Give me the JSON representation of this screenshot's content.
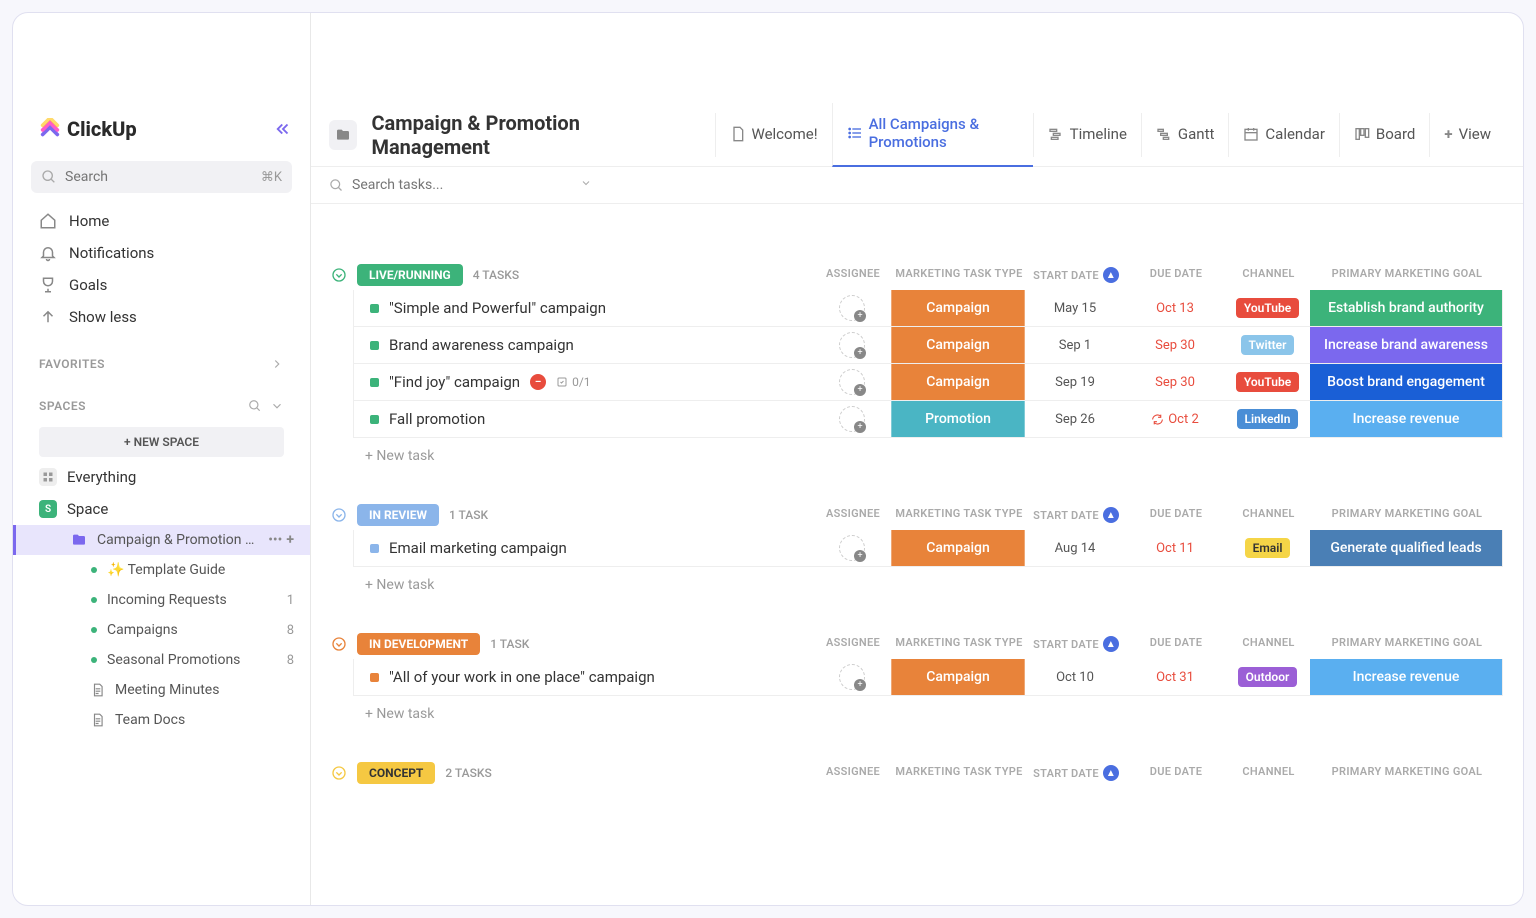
{
  "brand": "ClickUp",
  "sidebar": {
    "search_placeholder": "Search",
    "search_shortcut": "⌘K",
    "nav": [
      {
        "label": "Home"
      },
      {
        "label": "Notifications"
      },
      {
        "label": "Goals"
      },
      {
        "label": "Show less"
      }
    ],
    "favorites_label": "FAVORITES",
    "spaces_label": "SPACES",
    "new_space": "NEW SPACE",
    "everything": "Everything",
    "space_name": "Space",
    "folder": {
      "name": "Campaign & Promotion M...",
      "items": [
        {
          "label": "✨ Template Guide",
          "dot": "#3cb37a"
        },
        {
          "label": "Incoming Requests",
          "dot": "#3cb37a",
          "count": "1"
        },
        {
          "label": "Campaigns",
          "dot": "#3cb37a",
          "count": "8"
        },
        {
          "label": "Seasonal Promotions",
          "dot": "#3cb37a",
          "count": "8"
        },
        {
          "label": "Meeting Minutes",
          "doc": true
        },
        {
          "label": "Team Docs",
          "doc": true
        }
      ]
    }
  },
  "header": {
    "title": "Campaign & Promotion Management",
    "tabs": [
      {
        "label": "Welcome!"
      },
      {
        "label": "All Campaigns & Promotions",
        "active": true
      },
      {
        "label": "Timeline"
      },
      {
        "label": "Gantt"
      },
      {
        "label": "Calendar"
      },
      {
        "label": "Board"
      },
      {
        "label": "View",
        "add": true
      }
    ],
    "search_placeholder": "Search tasks..."
  },
  "columns": {
    "assignee": "ASSIGNEE",
    "type": "MARKETING TASK TYPE",
    "start": "START DATE",
    "due": "DUE DATE",
    "channel": "CHANNEL",
    "goal": "PRIMARY MARKETING GOAL"
  },
  "groups": [
    {
      "status": "LIVE/RUNNING",
      "pill_color": "#3cb37a",
      "count": "4 TASKS",
      "collapse_color": "#3cb37a",
      "tasks": [
        {
          "name": "\"Simple and Powerful\" campaign",
          "dot": "#3cb37a",
          "type": "Campaign",
          "type_color": "#e8833a",
          "start": "May 15",
          "due": "Oct 13",
          "due_red": true,
          "channel": "YouTube",
          "channel_color": "#e84c3d",
          "goal": "Establish brand authority",
          "goal_color": "#3cb37a"
        },
        {
          "name": "Brand awareness campaign",
          "dot": "#3cb37a",
          "type": "Campaign",
          "type_color": "#e8833a",
          "start": "Sep 1",
          "due": "Sep 30",
          "due_red": true,
          "channel": "Twitter",
          "channel_color": "#8bc5ea",
          "goal": "Increase brand awareness",
          "goal_color": "#7b68ee"
        },
        {
          "name": "\"Find joy\" campaign",
          "dot": "#3cb37a",
          "blocked": true,
          "subtasks": "0/1",
          "type": "Campaign",
          "type_color": "#e8833a",
          "start": "Sep 19",
          "due": "Sep 30",
          "due_red": true,
          "channel": "YouTube",
          "channel_color": "#e84c3d",
          "goal": "Boost brand engagement",
          "goal_color": "#1a5fd6"
        },
        {
          "name": "Fall promotion",
          "dot": "#3cb37a",
          "type": "Promotion",
          "type_color": "#4ab5c4",
          "start": "Sep 26",
          "due": "Oct 2",
          "due_red": true,
          "recurring": true,
          "channel": "LinkedIn",
          "channel_color": "#4a8ed6",
          "channel_text": "#fff",
          "goal": "Increase revenue",
          "goal_color": "#5aaff0"
        }
      ]
    },
    {
      "status": "IN REVIEW",
      "pill_color": "#8bb5ea",
      "count": "1 TASK",
      "collapse_color": "#8bb5ea",
      "tasks": [
        {
          "name": "Email marketing campaign",
          "dot": "#8bb5ea",
          "type": "Campaign",
          "type_color": "#e8833a",
          "start": "Aug 14",
          "due": "Oct 11",
          "due_red": true,
          "channel": "Email",
          "channel_color": "#f5d547",
          "channel_text": "#333",
          "goal": "Generate qualified leads",
          "goal_color": "#4a7fb5"
        }
      ]
    },
    {
      "status": "IN DEVELOPMENT",
      "pill_color": "#e8833a",
      "count": "1 TASK",
      "collapse_color": "#e8833a",
      "tasks": [
        {
          "name": "\"All of your work in one place\" campaign",
          "dot": "#e8833a",
          "type": "Campaign",
          "type_color": "#e8833a",
          "start": "Oct 10",
          "due": "Oct 31",
          "due_red": true,
          "channel": "Outdoor",
          "channel_color": "#9b5fd6",
          "goal": "Increase revenue",
          "goal_color": "#5aaff0"
        }
      ]
    },
    {
      "status": "CONCEPT",
      "pill_color": "#f5c842",
      "pill_text": "#333",
      "count": "2 TASKS",
      "collapse_color": "#f5c842",
      "tasks": []
    }
  ],
  "new_task_label": "+ New task"
}
